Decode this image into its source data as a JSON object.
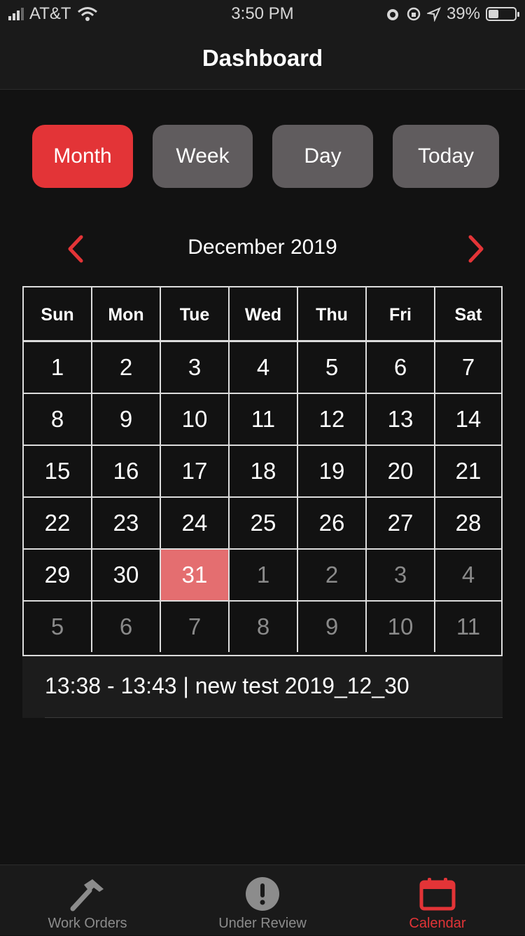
{
  "status_bar": {
    "carrier": "AT&T",
    "time": "3:50 PM",
    "battery": "39%",
    "battery_level": 0.39
  },
  "header": {
    "title": "Dashboard"
  },
  "segments": [
    {
      "label": "Month",
      "active": true
    },
    {
      "label": "Week",
      "active": false
    },
    {
      "label": "Day",
      "active": false
    },
    {
      "label": "Today",
      "active": false
    }
  ],
  "calendar": {
    "month_label": "December 2019",
    "weekdays": [
      "Sun",
      "Mon",
      "Tue",
      "Wed",
      "Thu",
      "Fri",
      "Sat"
    ],
    "weeks": [
      [
        {
          "d": "1",
          "o": false
        },
        {
          "d": "2",
          "o": false
        },
        {
          "d": "3",
          "o": false
        },
        {
          "d": "4",
          "o": false
        },
        {
          "d": "5",
          "o": false
        },
        {
          "d": "6",
          "o": false
        },
        {
          "d": "7",
          "o": false
        }
      ],
      [
        {
          "d": "8",
          "o": false
        },
        {
          "d": "9",
          "o": false
        },
        {
          "d": "10",
          "o": false
        },
        {
          "d": "11",
          "o": false
        },
        {
          "d": "12",
          "o": false
        },
        {
          "d": "13",
          "o": false
        },
        {
          "d": "14",
          "o": false
        }
      ],
      [
        {
          "d": "15",
          "o": false
        },
        {
          "d": "16",
          "o": false
        },
        {
          "d": "17",
          "o": false
        },
        {
          "d": "18",
          "o": false
        },
        {
          "d": "19",
          "o": false
        },
        {
          "d": "20",
          "o": false
        },
        {
          "d": "21",
          "o": false
        }
      ],
      [
        {
          "d": "22",
          "o": false
        },
        {
          "d": "23",
          "o": false
        },
        {
          "d": "24",
          "o": false
        },
        {
          "d": "25",
          "o": false
        },
        {
          "d": "26",
          "o": false
        },
        {
          "d": "27",
          "o": false
        },
        {
          "d": "28",
          "o": false
        }
      ],
      [
        {
          "d": "29",
          "o": false
        },
        {
          "d": "30",
          "o": false
        },
        {
          "d": "31",
          "o": false,
          "sel": true
        },
        {
          "d": "1",
          "o": true
        },
        {
          "d": "2",
          "o": true
        },
        {
          "d": "3",
          "o": true
        },
        {
          "d": "4",
          "o": true
        }
      ],
      [
        {
          "d": "5",
          "o": true
        },
        {
          "d": "6",
          "o": true
        },
        {
          "d": "7",
          "o": true
        },
        {
          "d": "8",
          "o": true
        },
        {
          "d": "9",
          "o": true
        },
        {
          "d": "10",
          "o": true
        },
        {
          "d": "11",
          "o": true
        }
      ]
    ]
  },
  "events": [
    {
      "text": "13:38 - 13:43  | new test 2019_12_30"
    }
  ],
  "tabs": [
    {
      "label": "Work Orders",
      "icon": "hammer-icon",
      "active": false
    },
    {
      "label": "Under Review",
      "icon": "exclamation-icon",
      "active": false
    },
    {
      "label": "Calendar",
      "icon": "calendar-icon",
      "active": true
    }
  ],
  "colors": {
    "accent": "#e33437",
    "selected_day": "#e46e70",
    "segment_inactive": "#605c5e",
    "background": "#121212"
  }
}
